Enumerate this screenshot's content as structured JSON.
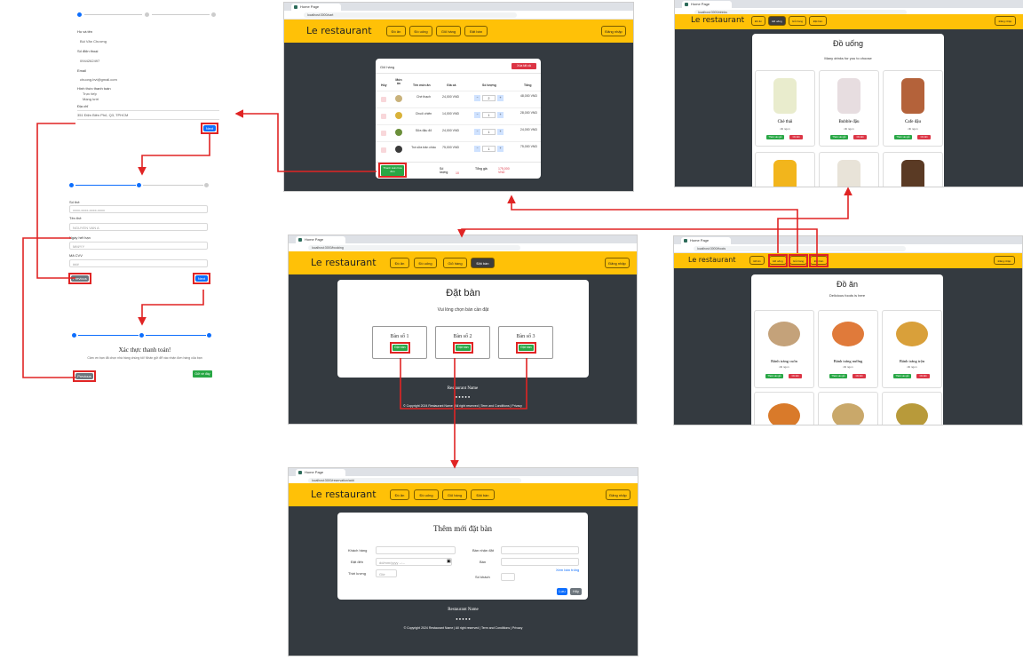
{
  "brand": "Le restaurant",
  "nav": {
    "food": "Đồ ăn",
    "drinks": "Đồ uống",
    "cart": "Giỏ hàng",
    "booking": "Đặt bàn",
    "login": "Đăng nhập"
  },
  "browser": {
    "tab_title": "Home Page",
    "url_cart": "localhost:3000/cart",
    "url_drinks": "localhost:3000/drinks",
    "url_booking": "localhost:3000/booking",
    "url_food": "localhost:3000/foods",
    "url_add": "localhost:3000/reservation/add"
  },
  "checkout_step1": {
    "name_label": "Họ và tên",
    "name_value": "Bùi Văn Chương",
    "phone_label": "Số điện thoại",
    "phone_value": "0944262497",
    "email_label": "Email",
    "email_value": "chuong.bvt@gmail.com",
    "payment_label": "Hình thức thanh toán",
    "payment_opt1": "Trực tiếp",
    "payment_opt2": "Mạng lưới",
    "address_label": "Địa chỉ",
    "address_value": "351 Điện Biên Phủ, Q3, TPHCM",
    "next": "Next"
  },
  "checkout_step2": {
    "card_number_label": "Số thẻ",
    "card_number_ph": "xxxx-xxxx-xxxx-xxxx",
    "card_name_label": "Tên thẻ",
    "card_name_ph": "NGUYEN VAN A",
    "expiry_label": "Ngày hết hạn",
    "expiry_ph": "MM/YY",
    "cvv_label": "Mã CVV",
    "cvv_ph": "###",
    "previous": "Previous",
    "next": "Next"
  },
  "checkout_step3": {
    "title": "Xác thực thanh toán!",
    "message": "Cảm ơn bạn đã chọn nhà hàng chúng tôi! Nhấn gửi để xác nhận đơn hàng của bạn",
    "previous": "Previous",
    "submit": "Gửi về đây"
  },
  "cart": {
    "title": "Giỏ hàng",
    "clear": "Xóa tất cả",
    "headers": [
      "Hủy",
      "Món ăn",
      "Tên món ăn",
      "Giá cả",
      "Số lượng",
      "Tổng"
    ],
    "rows": [
      {
        "name": "Chè thạch",
        "price": "24,000 VND",
        "qty": "2",
        "total": "48,000 VND"
      },
      {
        "name": "Chuối chiên",
        "price": "14,000 VND",
        "qty": "1",
        "total": "28,000 VND"
      },
      {
        "name": "Sữa đậu đỏ",
        "price": "24,000 VND",
        "qty": "1",
        "total": "24,000 VND"
      },
      {
        "name": "Trà sữa trân châu",
        "price": "75,000 VND",
        "qty": "1",
        "total": "75,000 VND"
      }
    ],
    "checkout": "Thanh toán hóa đơn",
    "qty_label": "Số lượng",
    "qty_value": "10",
    "total_label": "Tổng giá",
    "total_value": "175,000 VND"
  },
  "drinks": {
    "title": "Đồ uống",
    "subtitle": "Many drinks for you to choose",
    "items": [
      {
        "name": "Chè thái",
        "desc": "rất ngon"
      },
      {
        "name": "Bubble đậu",
        "desc": "rất ngon"
      },
      {
        "name": "Cafe đậu",
        "desc": "rất ngon"
      }
    ],
    "add": "Thêm vào giỏ",
    "detail": "Chi tiết"
  },
  "booking": {
    "title": "Đặt bàn",
    "subtitle": "Vui lòng chọn bàn cần đặt",
    "tables": [
      "Bàn số 1",
      "Bàn số 2",
      "Bàn số 3"
    ],
    "book": "Đặt bàn"
  },
  "footer": {
    "name": "Restaurant Name",
    "copy": "© Copyright 2024 Restaurant Name | All right reserved | Term and Conditions | Privacy"
  },
  "food": {
    "title": "Đồ ăn",
    "subtitle": "Delicious foods is here",
    "items": [
      {
        "name": "Bánh tráng cuốn",
        "desc": "rất ngon"
      },
      {
        "name": "Bánh tráng nướng",
        "desc": "rất ngon"
      },
      {
        "name": "Bánh tráng trộn",
        "desc": "rất ngon"
      }
    ],
    "add": "Thêm vào giỏ",
    "detail": "Chi tiết"
  },
  "add_booking": {
    "title": "Thêm mới đặt bàn",
    "customer_label": "Khách hàng",
    "date_label": "Đặt đến",
    "date_ph": "dd/mm/yyyy --:--",
    "duration_label": "Thời lượng",
    "duration_ph": "Giờ",
    "pickup_label": "Bàn nhận đặt",
    "table_label": "Bàn",
    "table_link": "Xem bàn trống",
    "guests_label": "Số khách",
    "save": "Lưu",
    "cancel": "Hủy"
  },
  "colors": {
    "accent": "#ffc107",
    "dark": "#343a40",
    "highlight": "#e02424"
  }
}
